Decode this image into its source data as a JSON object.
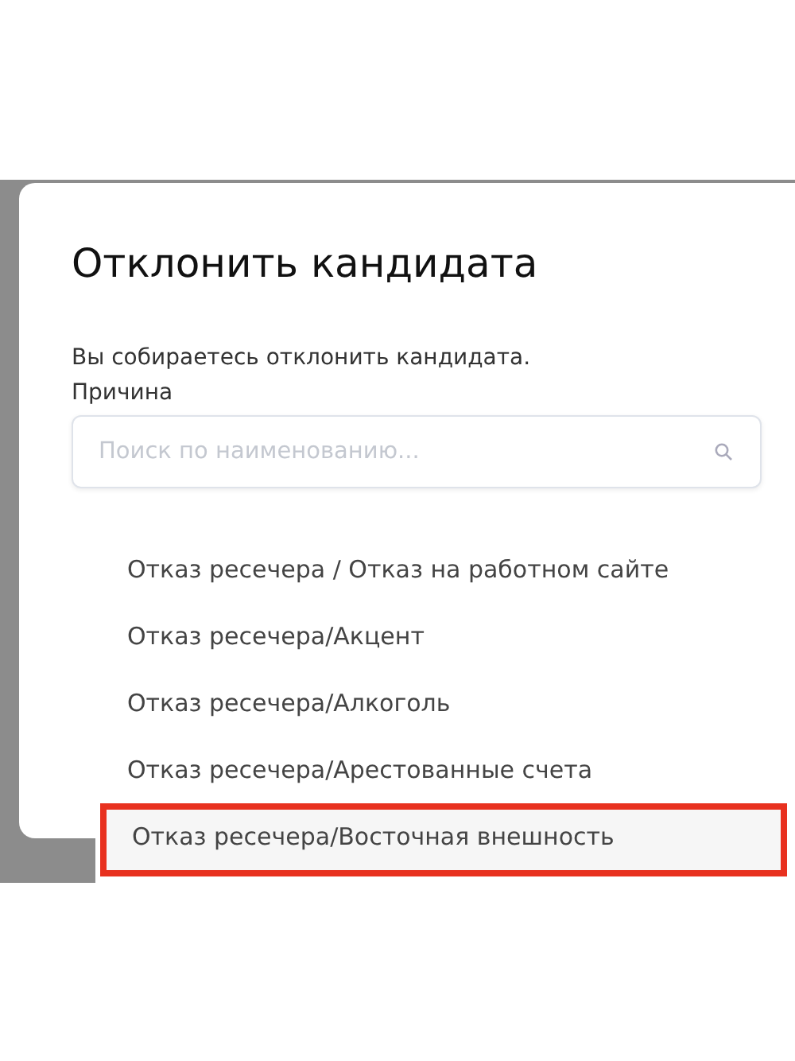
{
  "dialog": {
    "title": "Отклонить кандидата",
    "message": "Вы собираетесь отклонить кандидата.",
    "field_label": "Причина",
    "search": {
      "placeholder": "Поиск по наименованию..."
    },
    "options": [
      {
        "label": "Отказ ресечера / Отказ на работном сайте",
        "selected": false
      },
      {
        "label": "Отказ ресечера/Акцент",
        "selected": false
      },
      {
        "label": "Отказ ресечера/Алкоголь",
        "selected": false
      },
      {
        "label": "Отказ ресечера/Арестованные счета",
        "selected": false
      },
      {
        "label": "Отказ ресечера/Восточная внешность",
        "selected": true
      }
    ]
  }
}
